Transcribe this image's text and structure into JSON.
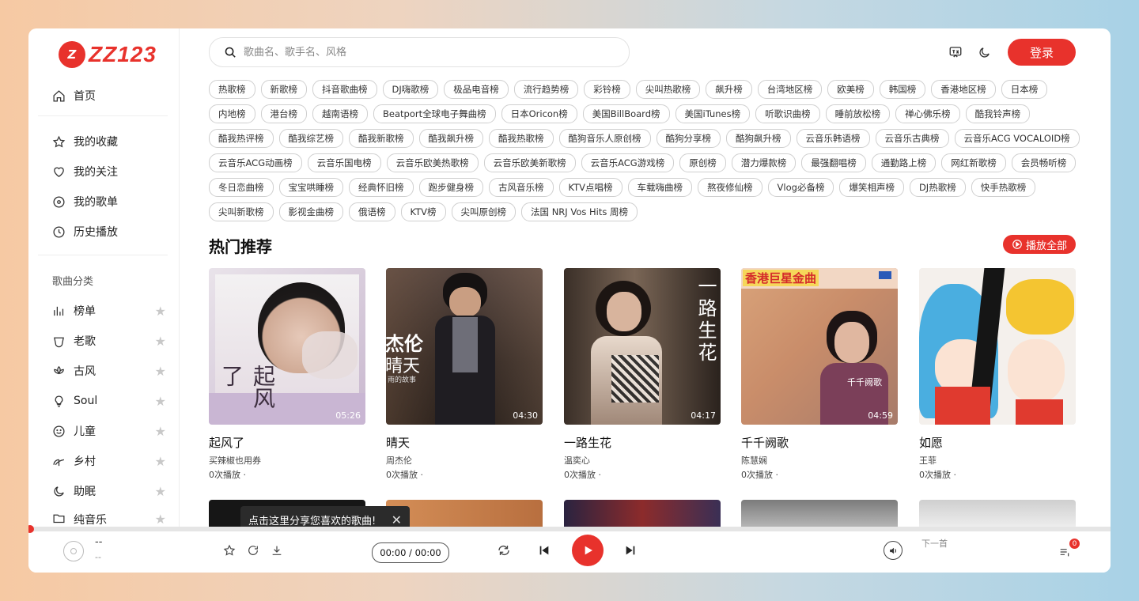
{
  "brand": {
    "logo_text": "ZZ123"
  },
  "nav": {
    "home": "首页",
    "favorites": "我的收藏",
    "following": "我的关注",
    "playlists": "我的歌单",
    "history": "历史播放"
  },
  "categories": {
    "title": "歌曲分类",
    "items": [
      "榜单",
      "老歌",
      "古风",
      "Soul",
      "儿童",
      "乡村",
      "助眠",
      "纯音乐"
    ]
  },
  "search": {
    "placeholder": "歌曲名、歌手名、风格"
  },
  "header": {
    "login_label": "登录"
  },
  "tags": [
    "热歌榜",
    "新歌榜",
    "抖音歌曲榜",
    "DJ嗨歌榜",
    "极品电音榜",
    "流行趋势榜",
    "彩铃榜",
    "尖叫热歌榜",
    "飙升榜",
    "台湾地区榜",
    "欧美榜",
    "韩国榜",
    "香港地区榜",
    "日本榜",
    "内地榜",
    "港台榜",
    "越南语榜",
    "Beatport全球电子舞曲榜",
    "日本Oricon榜",
    "美国BillBoard榜",
    "美国iTunes榜",
    "听歌识曲榜",
    "睡前放松榜",
    "禅心佛乐榜",
    "酷我铃声榜",
    "酷我热评榜",
    "酷我综艺榜",
    "酷我新歌榜",
    "酷我飙升榜",
    "酷我热歌榜",
    "酷狗音乐人原创榜",
    "酷狗分享榜",
    "酷狗飙升榜",
    "云音乐韩语榜",
    "云音乐古典榜",
    "云音乐ACG VOCALOID榜",
    "云音乐ACG动画榜",
    "云音乐国电榜",
    "云音乐欧美热歌榜",
    "云音乐欧美新歌榜",
    "云音乐ACG游戏榜",
    "原创榜",
    "潜力爆款榜",
    "最强翻唱榜",
    "通勤路上榜",
    "网红新歌榜",
    "会员畅听榜",
    "冬日恋曲榜",
    "宝宝哄睡榜",
    "经典怀旧榜",
    "跑步健身榜",
    "古风音乐榜",
    "KTV点唱榜",
    "车载嗨曲榜",
    "熬夜修仙榜",
    "Vlog必备榜",
    "爆笑相声榜",
    "DJ热歌榜",
    "快手热歌榜",
    "尖叫新歌榜",
    "影视金曲榜",
    "俄语榜",
    "KTV榜",
    "尖叫原创榜",
    "法国 NRJ Vos Hits 周榜"
  ],
  "section": {
    "title": "热门推荐",
    "play_all": "播放全部"
  },
  "songs": [
    {
      "title": "起风了",
      "artist": "买辣椒也用券",
      "plays": "0次播放 ·",
      "duration": "05:26"
    },
    {
      "title": "晴天",
      "artist": "周杰伦",
      "plays": "0次播放 ·",
      "duration": "04:30"
    },
    {
      "title": "一路生花",
      "artist": "温奕心",
      "plays": "0次播放 ·",
      "duration": "04:17"
    },
    {
      "title": "千千阙歌",
      "artist": "陈慧娴",
      "plays": "0次播放 ·",
      "duration": "04:59"
    },
    {
      "title": "如愿",
      "artist": "王菲",
      "plays": "0次播放 ·",
      "duration": ""
    }
  ],
  "cover_text": {
    "s1": "起风了",
    "s2_big": "杰伦",
    "s2_sub": "晴天",
    "s2_small": "雨的故事",
    "s3": "一路生花",
    "s4_banner": "香港巨星金曲",
    "s4_name": "千千阙歌"
  },
  "tooltip": {
    "text": "点击这里分享您喜欢的歌曲!"
  },
  "player": {
    "title": "--",
    "artist": "--",
    "time": "00:00 / 00:00",
    "next_label": "下一首",
    "queue_count": "0"
  },
  "colors": {
    "accent": "#e8322c"
  }
}
